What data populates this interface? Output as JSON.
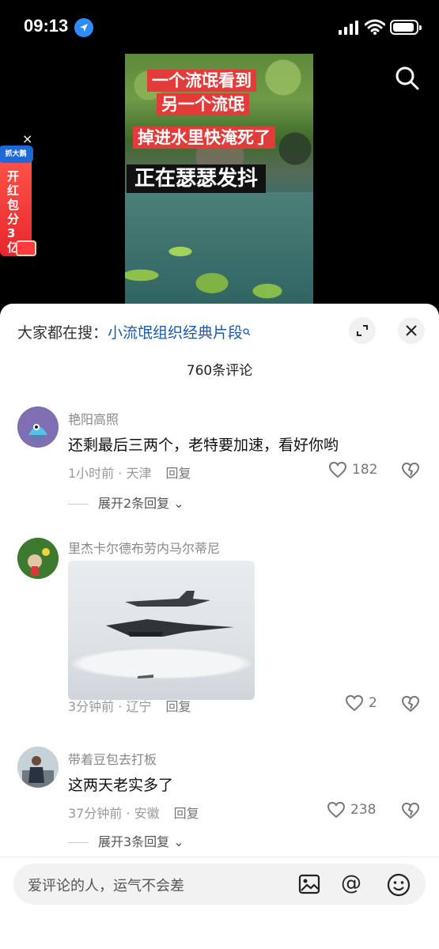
{
  "status_bar": {
    "time": "09:13"
  },
  "video": {
    "captions": [
      "一个流氓看到",
      "另一个流氓",
      "掉进水里快淹死了",
      "正在瑟瑟发抖"
    ]
  },
  "promo": {
    "badge": "抓大鹅",
    "text": "开红包分3亿",
    "close": "×"
  },
  "sheet": {
    "search_prefix": "大家都在搜：",
    "search_keyword": "小流氓组织经典片段",
    "comment_count": "760条评论"
  },
  "comments": [
    {
      "name": "艳阳高照",
      "text": "还剩最后三两个，老特要加速，看好你哟",
      "meta": "1小时前 · 天津",
      "reply": "回复",
      "likes": "182",
      "expand": "展开2条回复"
    },
    {
      "name": "里杰卡尔德布劳内马尔蒂尼",
      "text": "",
      "meta": "3分钟前 · 辽宁",
      "reply": "回复",
      "likes": "2",
      "expand": ""
    },
    {
      "name": "带着豆包去打板",
      "text": "这两天老实多了",
      "meta": "37分钟前 · 安徽",
      "reply": "回复",
      "likes": "238",
      "expand": "展开3条回复"
    }
  ],
  "input": {
    "placeholder": "爱评论的人，运气不会差",
    "at_symbol": "@"
  },
  "colors": {
    "keyword_blue": "#1d5aa8",
    "caption_red": "#e33a3a",
    "promo_red": "#e8262e"
  }
}
